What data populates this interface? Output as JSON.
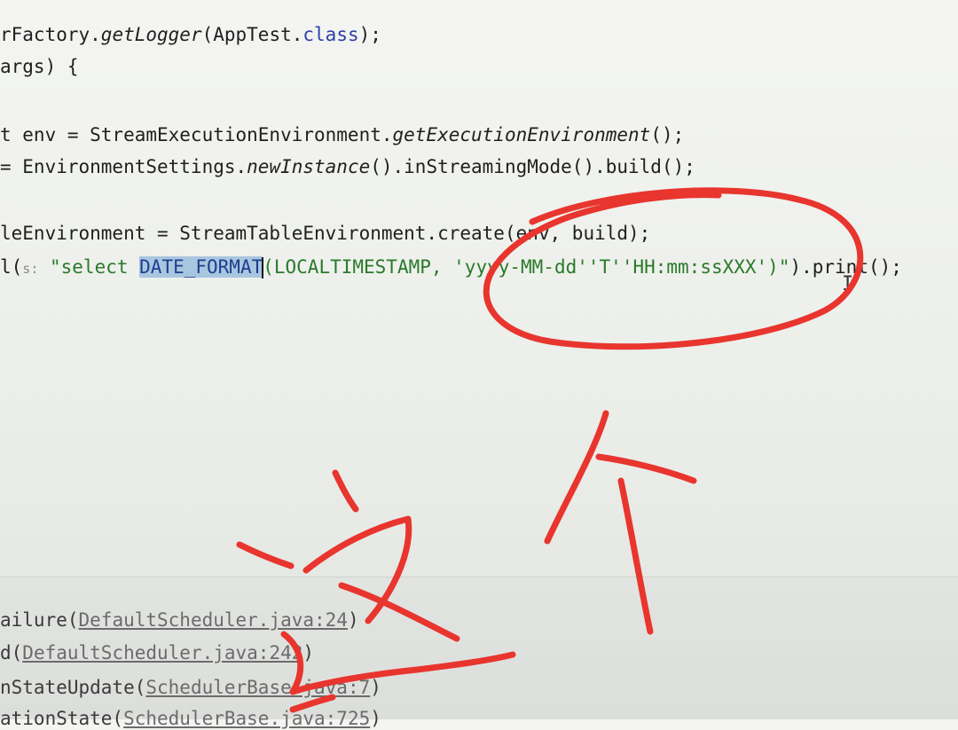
{
  "editor": {
    "lines": [
      {
        "parts": [
          "rFactory.",
          "getLogger",
          "(AppTest.",
          "class",
          ");"
        ]
      },
      {
        "text": "args) {"
      },
      {
        "parts": [
          "t env = StreamExecutionEnvironment.",
          "getExecutionEnvironment",
          "();"
        ]
      },
      {
        "parts": [
          "= EnvironmentSettings.",
          "newInstance",
          "().inStreamingMode().build();"
        ]
      },
      {
        "text": "leEnvironment = StreamTableEnvironment.create(env, build);"
      },
      {
        "parts": [
          "l(",
          "s:",
          " \"select ",
          "DATE_FORMAT",
          "(LOCALTIMESTAMP, 'yyyy-MM-dd''T''HH:mm:ssXXX')\"",
          ").print();"
        ]
      }
    ]
  },
  "console": {
    "lines": [
      {
        "method": "ailure(",
        "link": "DefaultScheduler.java:24",
        "tail": ")"
      },
      {
        "method": "d(",
        "link": "DefaultScheduler.java:242",
        "tail": ")"
      },
      {
        "method": "nStateUpdate(",
        "link": "SchedulerBase.java:7",
        "tail": ")"
      },
      {
        "method": "ationState(",
        "link": "SchedulerBase.java:725",
        "tail": ")"
      }
    ]
  },
  "annotation": {
    "color": "#e8352e",
    "shapes": [
      "circle-around-format-string",
      "arrow-pointing-up",
      "handwritten-characters"
    ]
  }
}
